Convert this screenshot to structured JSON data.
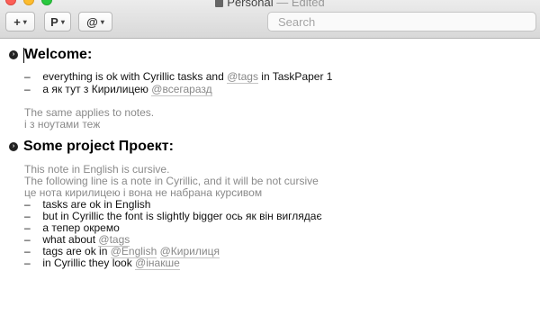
{
  "window": {
    "title": "Personal",
    "separator": " — ",
    "edited": "Edited"
  },
  "toolbar": {
    "add_label": "+",
    "project_label": "P",
    "tag_label": "@"
  },
  "search": {
    "placeholder": "Search"
  },
  "projects": [
    {
      "title": "Welcome:",
      "items": [
        {
          "type": "task",
          "text": "everything is ok with Cyrillic tasks and ",
          "tag": "@tags",
          "after": " in TaskPaper 1"
        },
        {
          "type": "task",
          "text": "а як тут з Кирилицею ",
          "tag": "@всегаразд"
        },
        {
          "type": "note",
          "text": "The same applies to notes."
        },
        {
          "type": "note",
          "text": "і з ноутами теж"
        }
      ]
    },
    {
      "title": "Some project Проект:",
      "items": [
        {
          "type": "note",
          "text": "This note in English is cursive."
        },
        {
          "type": "note",
          "text": "The following line is a note in Cyrillic, and it will be not cursive"
        },
        {
          "type": "note",
          "text": "це нота кирилицею і вона не набрана курсивом"
        },
        {
          "type": "task",
          "text": "tasks are ok in English"
        },
        {
          "type": "task",
          "text": "but in Cyrillic the font is slightly bigger ось як він виглядає"
        },
        {
          "type": "task",
          "text": "а тепер окремо"
        },
        {
          "type": "task",
          "text": "what about ",
          "tag": "@tags"
        },
        {
          "type": "task",
          "text": "tags are ok in ",
          "tag": "@English",
          "tag2": "@Кирилиця"
        },
        {
          "type": "task",
          "text": "in Cyrillic they look ",
          "tag": "@інакше"
        }
      ]
    }
  ]
}
